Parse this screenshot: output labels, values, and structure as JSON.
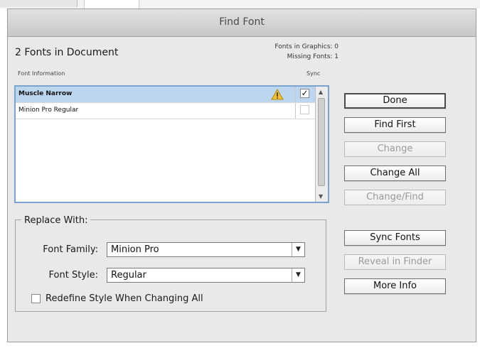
{
  "dialog": {
    "title": "Find Font",
    "fonts_count": "2 Fonts in Document",
    "fonts_in_graphics": "Fonts in Graphics: 0",
    "missing_fonts": "Missing Fonts: 1",
    "columns": {
      "font_information": "Font Information",
      "sync": "Sync"
    },
    "fonts": [
      {
        "name": "Muscle Narrow",
        "selected": true,
        "warning": true,
        "sync_checked": true,
        "sync_mark": "✓"
      },
      {
        "name": "Minion Pro Regular",
        "selected": false,
        "warning": false,
        "sync_checked": false,
        "sync_mark": ""
      }
    ],
    "buttons": {
      "done": "Done",
      "find_first": "Find First",
      "change": "Change",
      "change_all": "Change All",
      "change_find": "Change/Find",
      "sync_fonts": "Sync Fonts",
      "reveal_in_finder": "Reveal in Finder",
      "more_info": "More Info"
    },
    "replace_with": {
      "legend": "Replace With:",
      "font_family_label": "Font Family:",
      "font_family_value": "Minion Pro",
      "font_style_label": "Font Style:",
      "font_style_value": "Regular",
      "redefine_label": "Redefine Style When Changing All",
      "redefine_checked": false
    },
    "icons": {
      "warning": "warning-triangle-icon",
      "dropdown": "chevron-down-icon",
      "scroll_up": "scroll-up-arrow-icon",
      "scroll_down": "scroll-down-arrow-icon"
    },
    "colors": {
      "selection": "#bcd6f0",
      "list_focus_border": "#7aa3cf",
      "warning": "#f2c230"
    }
  }
}
